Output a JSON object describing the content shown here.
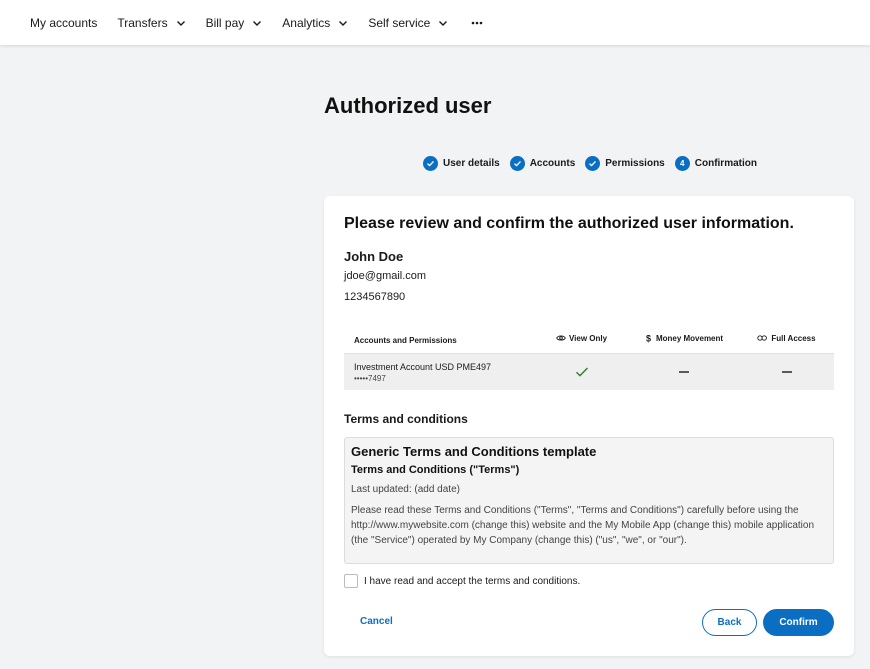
{
  "nav": {
    "items": [
      {
        "label": "My accounts",
        "has_dropdown": false
      },
      {
        "label": "Transfers",
        "has_dropdown": true
      },
      {
        "label": "Bill pay",
        "has_dropdown": true
      },
      {
        "label": "Analytics",
        "has_dropdown": true
      },
      {
        "label": "Self service",
        "has_dropdown": true
      }
    ],
    "more_icon": "more-horizontal-icon"
  },
  "page": {
    "title": "Authorized user"
  },
  "stepper": {
    "steps": [
      {
        "label": "User details",
        "state": "complete",
        "icon": "check-icon"
      },
      {
        "label": "Accounts",
        "state": "complete",
        "icon": "check-icon"
      },
      {
        "label": "Permissions",
        "state": "complete",
        "icon": "check-icon"
      },
      {
        "label": "Confirmation",
        "state": "current",
        "number": "4"
      }
    ]
  },
  "card": {
    "heading": "Please review and confirm the authorized user information.",
    "user": {
      "name": "John Doe",
      "email": "jdoe@gmail.com",
      "phone": "1234567890"
    },
    "permissions_table": {
      "headers": {
        "account": "Accounts and Permissions",
        "view_only": "View Only",
        "money_movement": "Money Movement",
        "full_access": "Full Access"
      },
      "rows": [
        {
          "account_name": "Investment Account USD PME497",
          "account_number": "•••••7497",
          "view_only": "check",
          "money_movement": "dash",
          "full_access": "dash"
        }
      ]
    },
    "terms": {
      "section_title": "Terms and conditions",
      "heading": "Generic Terms and Conditions template",
      "subheading": "Terms and Conditions (\"Terms\")",
      "last_updated": "Last updated: (add date)",
      "body": "Please read these Terms and Conditions (\"Terms\", \"Terms and Conditions\") carefully before using the http://www.mywebsite.com (change this) website and the My Mobile App (change this) mobile application (the \"Service\") operated by My Company (change this) (\"us\", \"we\", or \"our\")."
    },
    "accept_label": "I have read and accept the terms and conditions.",
    "accept_checked": false,
    "buttons": {
      "cancel": "Cancel",
      "back": "Back",
      "confirm": "Confirm"
    }
  },
  "colors": {
    "accent": "#0a6fc2",
    "check_green": "#2e7d32",
    "page_bg": "#f2f3f4"
  }
}
